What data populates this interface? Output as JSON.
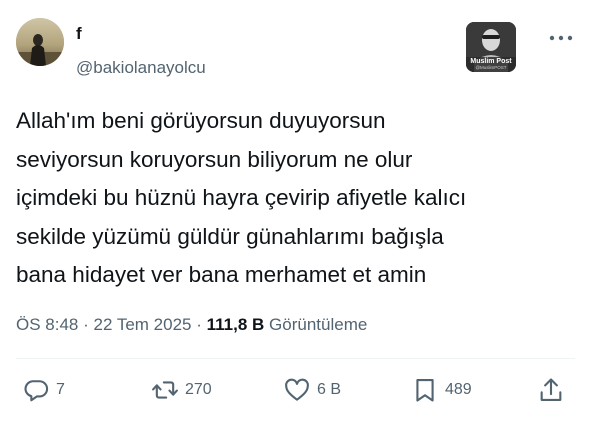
{
  "author": {
    "display_name": "f",
    "handle": "@bakiolanayolcu"
  },
  "affiliate_badge": {
    "label": "Muslim Post",
    "sub_label": "@MuslimPOST"
  },
  "tweet": {
    "text": "Allah'ım beni görüyorsun duyuyorsun\nseviyorsun koruyorsun biliyorum ne olur\niçimdeki bu hüznü hayra çevirip afiyetle kalıcı\nsekilde yüzümü güldür günahlarımı bağışla\nbana hidayet ver bana merhamet et amin",
    "time": "ÖS 8:48",
    "separator": "·",
    "date": "22 Tem 2025",
    "view_count": "111,8 B",
    "view_label": "Görüntüleme"
  },
  "actions": {
    "replies": "7",
    "reposts": "270",
    "likes": "6 B",
    "bookmarks": "489"
  },
  "icons": {
    "more": "more-horizontal-icon",
    "reply": "reply-icon",
    "repost": "repost-icon",
    "like": "heart-icon",
    "bookmark": "bookmark-icon",
    "share": "share-icon"
  },
  "colors": {
    "text": "#0f1419",
    "secondary": "#536471",
    "divider": "#eff3f4"
  }
}
